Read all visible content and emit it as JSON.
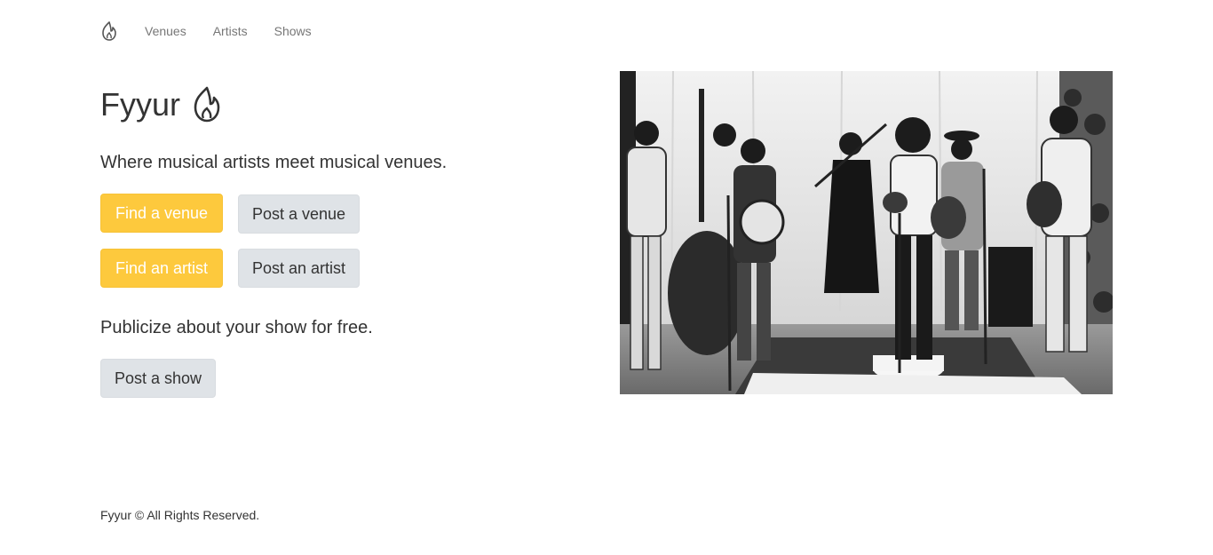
{
  "nav": {
    "brand_icon": "flame-icon",
    "items": [
      {
        "label": "Venues"
      },
      {
        "label": "Artists"
      },
      {
        "label": "Shows"
      }
    ]
  },
  "hero": {
    "title": "Fyyur",
    "title_icon": "flame-icon",
    "tagline": "Where musical artists meet musical venues.",
    "buttons": {
      "find_venue": "Find a venue",
      "post_venue": "Post a venue",
      "find_artist": "Find an artist",
      "post_artist": "Post an artist"
    },
    "publicize": "Publicize about your show for free.",
    "post_show": "Post a show",
    "image": "band-performance-photo"
  },
  "footer": {
    "text": "Fyyur © All Rights Reserved."
  },
  "colors": {
    "primary_button": "#fdc93d",
    "default_button": "#dfe3e7",
    "nav_link": "#777777",
    "text": "#333333"
  }
}
